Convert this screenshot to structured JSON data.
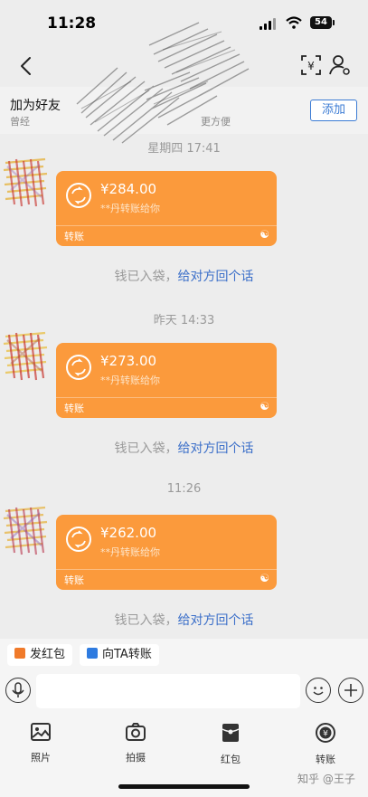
{
  "status_bar": {
    "time": "11:28",
    "battery": "54"
  },
  "add_friend": {
    "title": "加为好友",
    "subtitle": "曾经",
    "subtitle_tail": "更方便",
    "button": "添加"
  },
  "messages": [
    {
      "timestamp": "星期四 17:41",
      "amount": "¥284.00",
      "note": "**丹转账给你",
      "label": "转账",
      "system_text": "钱已入袋，",
      "system_link": "给对方回个话"
    },
    {
      "timestamp": "昨天 14:33",
      "amount": "¥273.00",
      "note": "**丹转账给你",
      "label": "转账",
      "system_text": "钱已入袋，",
      "system_link": "给对方回个话"
    },
    {
      "timestamp": "11:26",
      "amount": "¥262.00",
      "note": "**丹转账给你",
      "label": "转账",
      "system_text": "钱已入袋，",
      "system_link": "给对方回个话"
    }
  ],
  "quick_actions": [
    {
      "label": "发红包",
      "icon": "red-packet-icon",
      "color": "#f07a2a"
    },
    {
      "label": "向TA转账",
      "icon": "transfer-icon",
      "color": "#2e7be0"
    }
  ],
  "input": {
    "placeholder": ""
  },
  "toolbar": [
    {
      "label": "照片",
      "icon": "photo-icon"
    },
    {
      "label": "拍摄",
      "icon": "camera-icon"
    },
    {
      "label": "红包",
      "icon": "red-packet-icon"
    },
    {
      "label": "转账",
      "icon": "yuan-coin-icon"
    }
  ],
  "watermark": "知乎 @王子",
  "colors": {
    "bubble": "#fb9a3c",
    "link": "#3b6fc9",
    "accent": "#3b7bd4",
    "background": "#ededed"
  }
}
